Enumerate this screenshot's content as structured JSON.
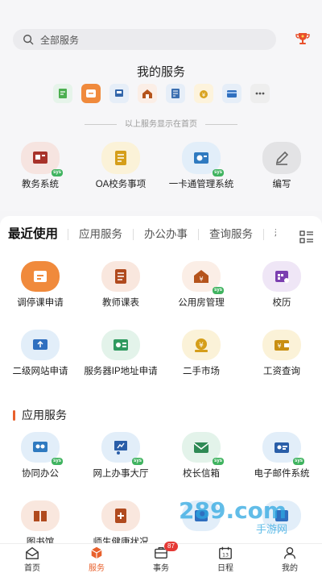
{
  "search": {
    "placeholder": "全部服务"
  },
  "my_services": {
    "title": "我的服务",
    "hint": "以上服务显示在首页",
    "mini_icons": [
      "task-icon",
      "calendar-icon",
      "system-icon",
      "house-icon",
      "book-icon",
      "money-icon",
      "card-icon",
      "more-icon"
    ]
  },
  "favorites": [
    {
      "label": "教务系统",
      "icon": "academic-system-icon",
      "sys": "sys"
    },
    {
      "label": "OA校务事项",
      "icon": "oa-affairs-icon"
    },
    {
      "label": "一卡通管理系统",
      "icon": "campus-card-icon",
      "sys": "sys"
    },
    {
      "label": "编写",
      "icon": "edit-icon"
    }
  ],
  "tabs": [
    "最近使用",
    "应用服务",
    "办公办事",
    "查询服务",
    "移"
  ],
  "recent": [
    {
      "label": "调停课申请",
      "icon": "class-adjust-icon"
    },
    {
      "label": "教师课表",
      "icon": "teacher-schedule-icon"
    },
    {
      "label": "公用房管理",
      "icon": "public-housing-icon",
      "sys": "sys"
    },
    {
      "label": "校历",
      "icon": "school-calendar-icon"
    },
    {
      "label": "二级网站申请",
      "icon": "website-apply-icon"
    },
    {
      "label": "服务器IP地址申请",
      "icon": "server-ip-icon"
    },
    {
      "label": "二手市场",
      "icon": "second-hand-icon"
    },
    {
      "label": "工资查询",
      "icon": "salary-query-icon"
    }
  ],
  "section_title": "应用服务",
  "apps": [
    {
      "label": "协同办公",
      "icon": "collab-office-icon",
      "sys": "sys"
    },
    {
      "label": "网上办事大厅",
      "icon": "online-hall-icon",
      "sys": "sys"
    },
    {
      "label": "校长信箱",
      "icon": "president-mailbox-icon",
      "sys": "sys"
    },
    {
      "label": "电子邮件系统",
      "icon": "email-system-icon",
      "sys": "sys"
    },
    {
      "label": "图书馆",
      "icon": "library-icon"
    },
    {
      "label": "师生健康状况",
      "icon": "health-icon"
    },
    {
      "label": "",
      "icon": "app-icon"
    },
    {
      "label": "",
      "icon": "app-icon"
    }
  ],
  "watermark": {
    "brand": "289.com",
    "sub": "手游网"
  },
  "nav": [
    {
      "label": "首页",
      "icon": "home-icon"
    },
    {
      "label": "服务",
      "icon": "service-icon",
      "active": true
    },
    {
      "label": "事务",
      "icon": "affairs-icon",
      "badge": "87"
    },
    {
      "label": "日程",
      "icon": "schedule-icon"
    },
    {
      "label": "我的",
      "icon": "profile-icon"
    }
  ],
  "colors": {
    "accent": "#e8602c",
    "sys_badge": "#3fb35f",
    "badge": "#e53935"
  }
}
